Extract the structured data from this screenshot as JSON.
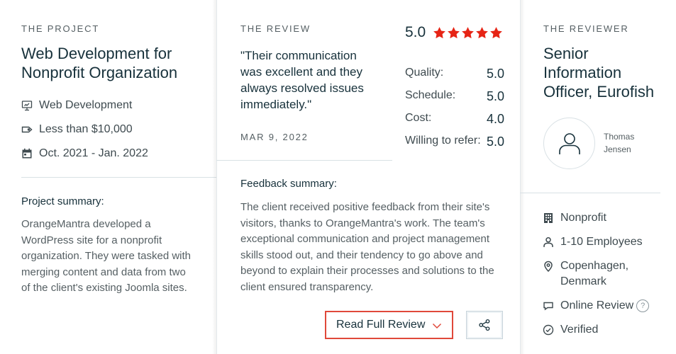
{
  "project": {
    "eyebrow": "THE PROJECT",
    "title_line1": "Web Development for",
    "title_line2": "Nonprofit Organization",
    "meta": [
      {
        "icon": "monitor-icon",
        "text": "Web Development"
      },
      {
        "icon": "price-tag-icon",
        "text": "Less than $10,000"
      },
      {
        "icon": "calendar-icon",
        "text": "Oct. 2021 - Jan. 2022"
      }
    ],
    "summary_label": "Project summary:",
    "summary_lines": [
      "OrangeMantra developed a",
      "WordPress site for a nonprofit",
      "organization. They were tasked with",
      "merging content and data from two",
      "of the client's existing Joomla sites."
    ]
  },
  "review": {
    "eyebrow": "THE REVIEW",
    "quote_lines": [
      "\"Their communication",
      "was excellent and they",
      "always resolved issues",
      "immediately.\""
    ],
    "date": "MAR 9, 2022",
    "overall": "5.0",
    "stars": 5,
    "star_color": "#e62415",
    "ratings": [
      {
        "label": "Quality:",
        "value": "5.0"
      },
      {
        "label": "Schedule:",
        "value": "5.0"
      },
      {
        "label": "Cost:",
        "value": "4.0"
      },
      {
        "label": "Willing to refer:",
        "value": "5.0"
      }
    ],
    "feedback_label": "Feedback summary:",
    "feedback_lines": [
      "The client received positive feedback from their site's",
      "visitors, thanks to OrangeMantra's work. The team's",
      "exceptional communication and project management",
      "skills stood out, and their tendency to go above and",
      "beyond to explain their processes and solutions to the",
      "client ensured transparency."
    ],
    "read_button": "Read Full Review",
    "button_border_color": "#e0483a",
    "share_icon": "share-icon"
  },
  "reviewer": {
    "eyebrow": "THE REVIEWER",
    "title_lines": [
      "Senior",
      "Information",
      "Officer, Eurofish"
    ],
    "name_line1": "Thomas",
    "name_line2": "Jensen",
    "details": [
      {
        "icon": "building-icon",
        "text": "Nonprofit"
      },
      {
        "icon": "person-icon",
        "text": "1-10 Employees"
      },
      {
        "icon": "location-pin-icon",
        "text_line1": "Copenhagen,",
        "text_line2": "Denmark"
      },
      {
        "icon": "chat-bubble-icon",
        "text": "Online Review",
        "help": "?"
      },
      {
        "icon": "check-circle-icon",
        "text": "Verified"
      }
    ]
  }
}
